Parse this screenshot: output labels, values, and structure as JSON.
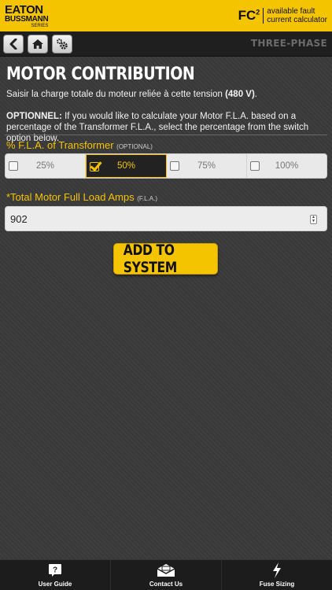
{
  "header": {
    "brand_top": "EATON",
    "brand_mid": "BUSSMANN",
    "brand_bottom": "SERIES",
    "app_logo": "FC",
    "app_logo_sup": "2",
    "app_line1": "available fault",
    "app_line2": "current calculator"
  },
  "nav": {
    "back_icon": "back-arrow-icon",
    "home_icon": "home-icon",
    "settings_icon": "gear-icon",
    "phase": "THREE-PHASE"
  },
  "main": {
    "title": "MOTOR CONTRIBUTION",
    "instruction_text": "Saisir la charge totale du moteur reliée à cette tension ",
    "instruction_voltage": "(480 V)",
    "instruction_end": ".",
    "optional_label": "OPTIONNEL:",
    "optional_text": " If you would like to calculate your Motor F.L.A. based on a percentage of the Transformer F.L.A., select the percentage from the switch option below.",
    "fla_label": "% F.L.A. of Transformer",
    "fla_label_small": "(OPTIONAL)",
    "percent_options": [
      {
        "label": "25%",
        "selected": false
      },
      {
        "label": "50%",
        "selected": true
      },
      {
        "label": "75%",
        "selected": false
      },
      {
        "label": "100%",
        "selected": false
      }
    ],
    "amps_label": "*Total Motor Full Load Amps",
    "amps_label_small": "(F.L.A.)",
    "amps_value": "902",
    "add_button": "ADD TO SYSTEM"
  },
  "tabs": [
    {
      "label": "User Guide",
      "icon": "question-icon"
    },
    {
      "label": "Contact Us",
      "icon": "envelope-icon"
    },
    {
      "label": "Fuse Sizing",
      "icon": "lightning-icon"
    }
  ],
  "colors": {
    "accent": "#f5c400",
    "background": "#3a3a3a",
    "bar": "#1c1c1c"
  }
}
